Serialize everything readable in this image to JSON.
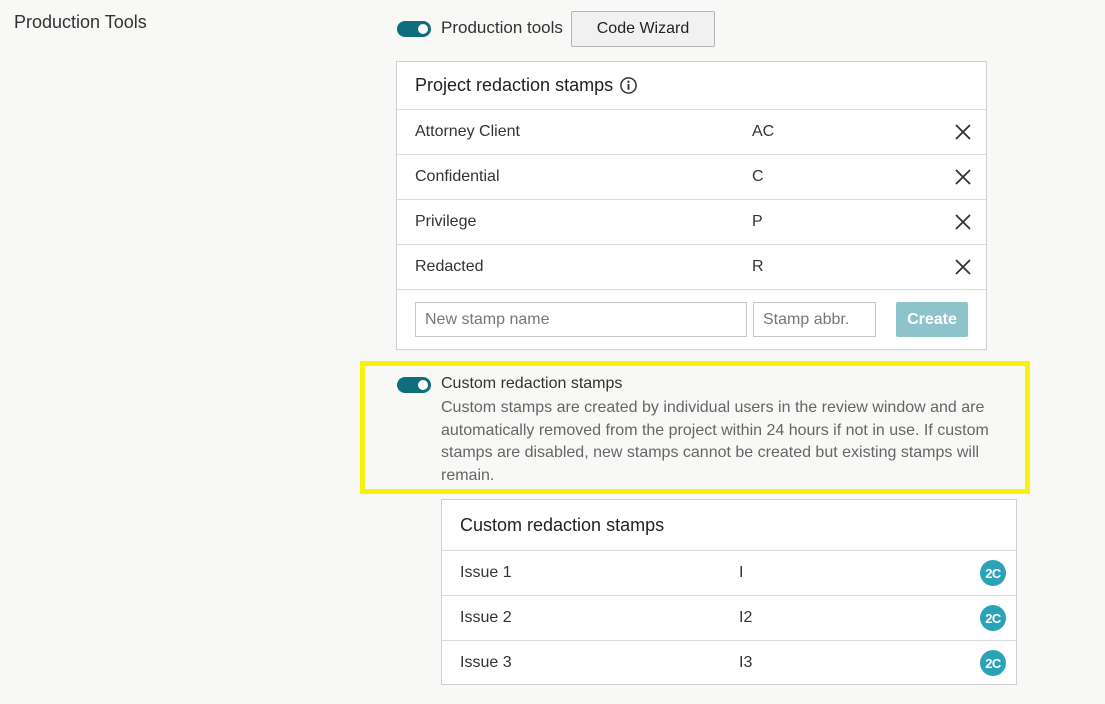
{
  "section": {
    "title": "Production Tools"
  },
  "production_tools": {
    "toggle_on": true,
    "label": "Production tools",
    "code_wizard_label": "Code Wizard"
  },
  "project_stamps": {
    "title": "Project redaction stamps",
    "rows": [
      {
        "name": "Attorney Client",
        "abbr": "AC"
      },
      {
        "name": "Confidential",
        "abbr": "C"
      },
      {
        "name": "Privilege",
        "abbr": "P"
      },
      {
        "name": "Redacted",
        "abbr": "R"
      }
    ],
    "new_name_placeholder": "New stamp name",
    "new_abbr_placeholder": "Stamp abbr.",
    "create_label": "Create"
  },
  "custom_setting": {
    "toggle_on": true,
    "label": "Custom redaction stamps",
    "description": "Custom stamps are created by individual users in the review window and are automatically removed from the project within 24 hours if not in use. If custom stamps are disabled, new stamps cannot be created but existing stamps will remain."
  },
  "custom_stamps": {
    "title": "Custom redaction stamps",
    "rows": [
      {
        "name": "Issue 1",
        "abbr": "I",
        "user": "2C"
      },
      {
        "name": "Issue 2",
        "abbr": "I2",
        "user": "2C"
      },
      {
        "name": "Issue 3",
        "abbr": "I3",
        "user": "2C"
      }
    ]
  },
  "colors": {
    "toggle": "#0e6e7e",
    "highlight": "#f7f10f",
    "badge": "#2aa3b8",
    "create_button": "#8fc3cb"
  }
}
